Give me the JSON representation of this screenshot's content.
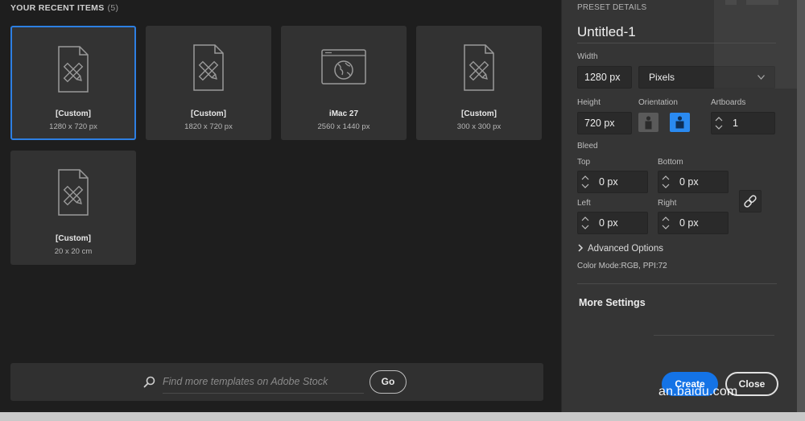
{
  "recent": {
    "header": "YOUR RECENT ITEMS",
    "count": "(5)",
    "items": [
      {
        "name": "[Custom]",
        "size": "1280 x 720 px",
        "icon": "document-pencil-ruler-icon"
      },
      {
        "name": "[Custom]",
        "size": "1820 x 720 px",
        "icon": "document-pencil-ruler-icon"
      },
      {
        "name": "iMac 27",
        "size": "2560 x 1440 px",
        "icon": "browser-globe-icon"
      },
      {
        "name": "[Custom]",
        "size": "300 x 300 px",
        "icon": "document-pencil-ruler-icon"
      },
      {
        "name": "[Custom]",
        "size": "20 x 20 cm",
        "icon": "document-pencil-ruler-icon"
      }
    ]
  },
  "search": {
    "placeholder": "Find more templates on Adobe Stock",
    "go_label": "Go"
  },
  "preset": {
    "title": "PRESET DETAILS",
    "doc_name": "Untitled-1",
    "width_label": "Width",
    "width_value": "1280 px",
    "unit": "Pixels",
    "height_label": "Height",
    "height_value": "720 px",
    "orientation_label": "Orientation",
    "artboards_label": "Artboards",
    "artboards_value": "1",
    "bleed_label": "Bleed",
    "top_label": "Top",
    "top_value": "0 px",
    "bottom_label": "Bottom",
    "bottom_value": "0 px",
    "left_label": "Left",
    "left_value": "0 px",
    "right_label": "Right",
    "right_value": "0 px",
    "advanced_label": "Advanced Options",
    "color_mode": "Color Mode:RGB, PPI:72",
    "more_settings": "More Settings",
    "create_label": "Create",
    "close_label": "Close"
  },
  "watermark": "an.baidu.com",
  "colors": {
    "accent": "#2d7fe2",
    "create_button": "#1473e6",
    "panel_bg": "#353535",
    "app_bg": "#1e1e1e"
  }
}
